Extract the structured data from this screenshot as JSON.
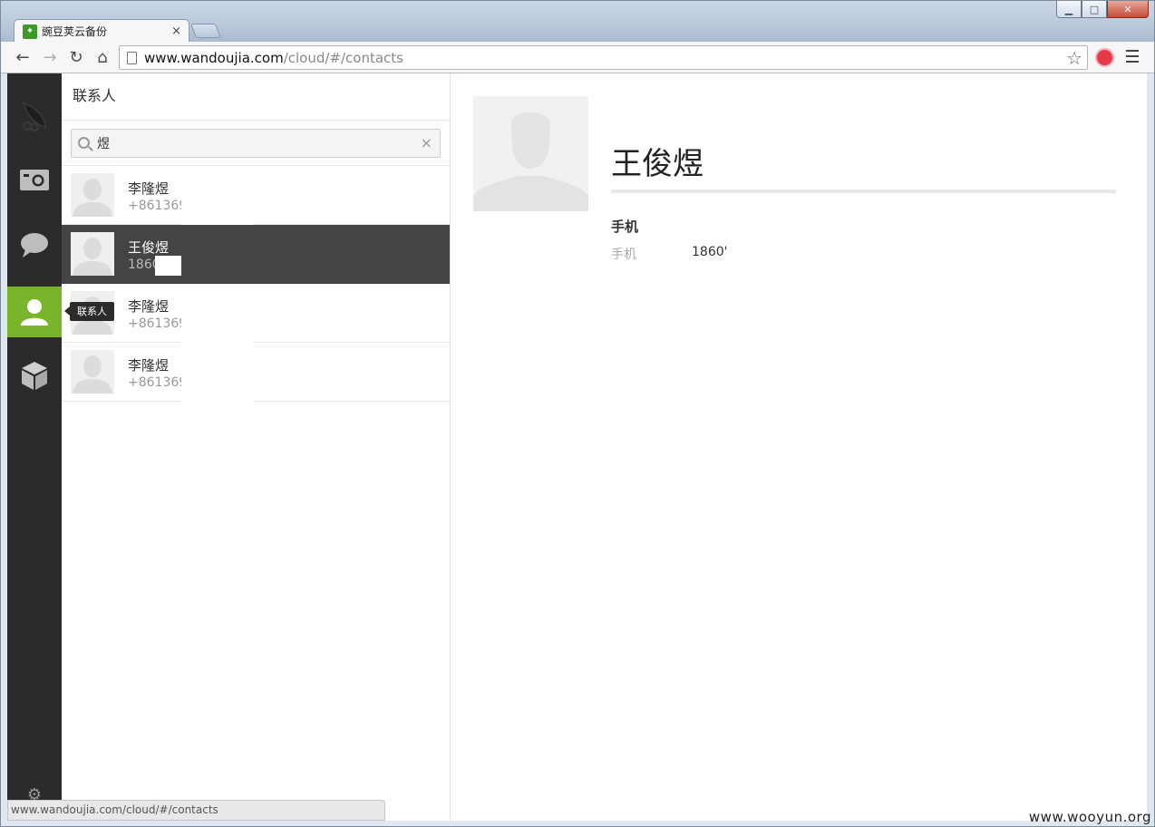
{
  "browser": {
    "tab_title": "豌豆荚云备份",
    "tab_close": "×",
    "url_host": "www.wandoujia.com",
    "url_path": "/cloud/#/contacts",
    "status_url": "www.wandoujia.com/cloud/#/contacts"
  },
  "rail": {
    "items": [
      {
        "icon": "wandoujia-logo-icon"
      },
      {
        "icon": "camera-icon"
      },
      {
        "icon": "message-bubble-icon"
      },
      {
        "icon": "contacts-person-icon",
        "active": true
      },
      {
        "icon": "app-box-icon"
      }
    ],
    "tooltip": "联系人",
    "settings_icon": "gear-icon",
    "accent": "#79b52a"
  },
  "list": {
    "header": "联系人",
    "search_value": "煜",
    "search_clear": "×",
    "contacts": [
      {
        "name": "李隆煜",
        "phone": "+861369",
        "selected": false
      },
      {
        "name": "王俊煜",
        "phone": "1860",
        "selected": true
      },
      {
        "name": "李隆煜",
        "phone": "+861369",
        "selected": false
      },
      {
        "name": "李隆煜",
        "phone": "+861369",
        "selected": false
      }
    ]
  },
  "detail": {
    "name": "王俊煜",
    "section_title": "手机",
    "field_label": "手机",
    "field_value": "1860'"
  },
  "watermark": "www.wooyun.org"
}
